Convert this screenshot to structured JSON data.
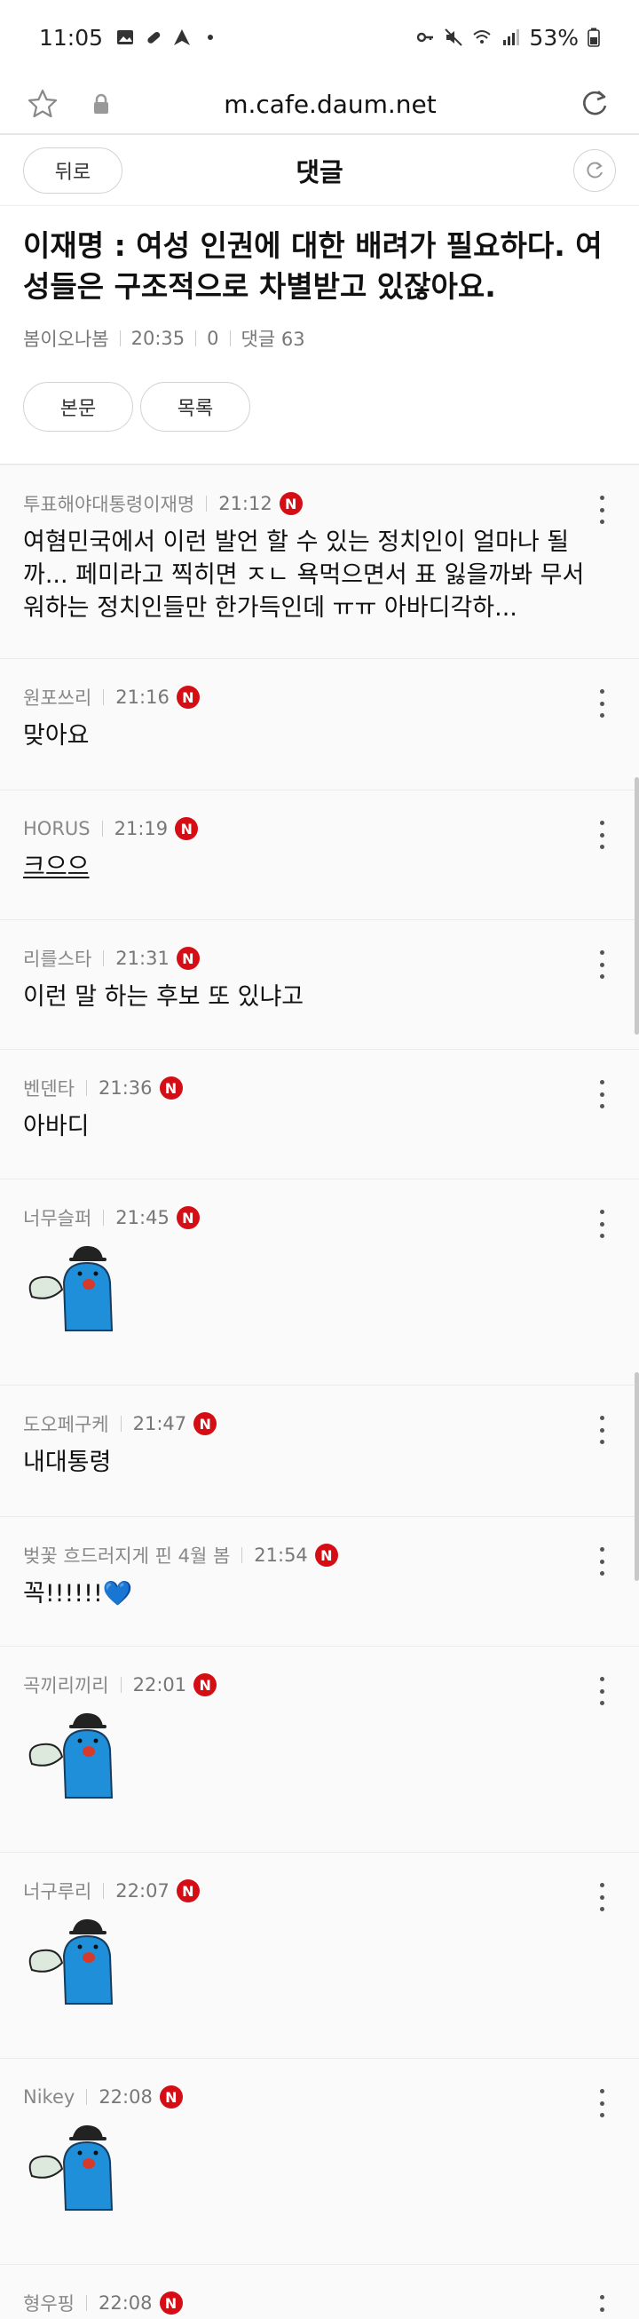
{
  "status": {
    "time": "11:05",
    "battery": "53%"
  },
  "browser": {
    "url": "m.cafe.daum.net"
  },
  "nav": {
    "back_label": "뒤로",
    "title": "댓글"
  },
  "post": {
    "title": "이재명 : 여성 인권에 대한 배려가 필요하다. 여성들은 구조적으로 차별받고 있잖아요.",
    "author": "봄이오나봄",
    "time": "20:35",
    "views": "0",
    "comments_label": "댓글 63",
    "body_button": "본문",
    "list_button": "목록"
  },
  "comments": [
    {
      "author": "투표해야대통령이재명",
      "time": "21:12",
      "badge": "N",
      "text": "여혐민국에서 이런 발언 할 수 있는 정치인이 얼마나 될까... 페미라고 찍히면 ㅈㄴ 욕먹으면서 표 잃을까봐 무서워하는 정치인들만 한가득인데 ㅠㅠ 아바디각하..."
    },
    {
      "author": "원포쓰리",
      "time": "21:16",
      "badge": "N",
      "text": "맞아요"
    },
    {
      "author": "HORUS",
      "time": "21:19",
      "badge": "N",
      "text": "크으으"
    },
    {
      "author": "리를스타",
      "time": "21:31",
      "badge": "N",
      "text": "이런 말 하는 후보 또 있냐고"
    },
    {
      "author": "벤덴타",
      "time": "21:36",
      "badge": "N",
      "text": "아바디"
    },
    {
      "author": "너무슬퍼",
      "time": "21:45",
      "badge": "N",
      "text": ""
    },
    {
      "author": "도오페구케",
      "time": "21:47",
      "badge": "N",
      "text": "내대통령"
    },
    {
      "author": "벚꽃 흐드러지게 핀 4월 봄",
      "time": "21:54",
      "badge": "N",
      "text": "꼭!!!!!!💙"
    },
    {
      "author": "곡끼리끼리",
      "time": "22:01",
      "badge": "N",
      "text": ""
    },
    {
      "author": "너구루리",
      "time": "22:07",
      "badge": "N",
      "text": ""
    },
    {
      "author": "Nikey",
      "time": "22:08",
      "badge": "N",
      "text": ""
    },
    {
      "author": "형우핑",
      "time": "22:08",
      "badge": "N",
      "text": ""
    }
  ],
  "icons": {
    "bookmark": "star-icon",
    "secure": "lock-icon",
    "reload": "reload-icon",
    "more": "more-vertical-icon",
    "sticker": "blue-character-sticker"
  },
  "colors": {
    "badge": "#d40e14",
    "sticker_body": "#1e8fd8"
  }
}
